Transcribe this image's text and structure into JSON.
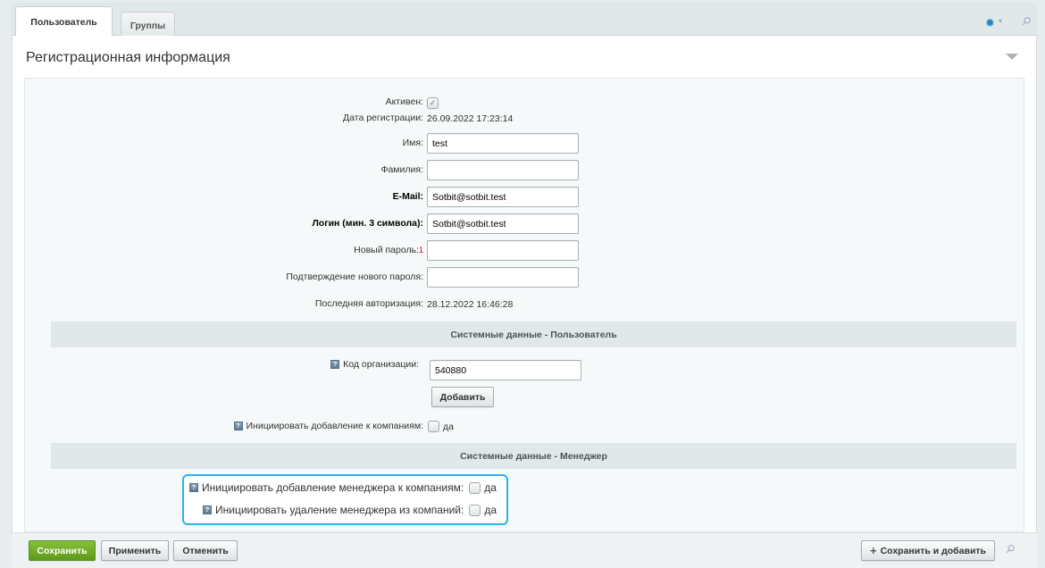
{
  "tabs": [
    {
      "label": "Пользователь",
      "active": true
    },
    {
      "label": "Группы",
      "active": false
    }
  ],
  "panel": {
    "title": "Регистрационная информация"
  },
  "fields": {
    "active_label": "Активен:",
    "active_checked": true,
    "reg_date_label": "Дата регистрации:",
    "reg_date_value": "26.09.2022 17:23:14",
    "name_label": "Имя:",
    "name_value": "test",
    "surname_label": "Фамилия:",
    "surname_value": "",
    "email_label": "E-Mail:",
    "email_value": "Sotbit@sotbit.test",
    "login_label": "Логин (мин. 3 символа):",
    "login_value": "Sotbit@sotbit.test",
    "password_label": "Новый пароль:",
    "password_note": "1",
    "confirm_password_label": "Подтверждение нового пароля:",
    "last_auth_label": "Последняя авторизация:",
    "last_auth_value": "28.12.2022 16:46:28"
  },
  "section_user": {
    "title": "Системные данные - Пользователь",
    "org_code_label": "Код организации:",
    "org_code_value": "540880",
    "add_button": "Добавить",
    "init_add_companies_label": "Инициировать добавление к компаниям:",
    "init_add_companies_option": "да"
  },
  "section_manager": {
    "title": "Системные данные - Менеджер",
    "init_add_manager_label": "Инициировать добавление менеджера к компаниям:",
    "init_add_manager_option": "да",
    "init_remove_manager_label": "Инициировать удаление менеджера из компаний:",
    "init_remove_manager_option": "да"
  },
  "footer": {
    "save": "Сохранить",
    "apply": "Применить",
    "cancel": "Отменить",
    "save_add": "Сохранить и добавить"
  },
  "icons": {
    "help_glyph": "?",
    "check_glyph": "✓",
    "plus_glyph": "+"
  },
  "colors": {
    "accent": "#28b4e6",
    "save_green": "#6aa823",
    "gear_blue": "#1d89c6"
  }
}
